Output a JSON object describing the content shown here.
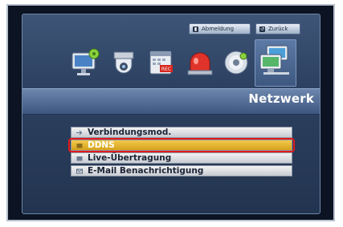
{
  "header": {
    "logout_label": "Abmeldung",
    "back_label": "Zurück"
  },
  "categories": [
    {
      "icon": "monitor-gear-icon"
    },
    {
      "icon": "camera-icon"
    },
    {
      "icon": "calendar-rec-icon"
    },
    {
      "icon": "alarm-icon"
    },
    {
      "icon": "disk-icon"
    },
    {
      "icon": "network-icon",
      "active": true
    }
  ],
  "section_title": "Netzwerk",
  "menu": {
    "items": [
      {
        "label": "Verbindungsmod.",
        "selected": false
      },
      {
        "label": "DDNS",
        "selected": true
      },
      {
        "label": "Live-Übertragung",
        "selected": false
      },
      {
        "label": "E-Mail Benachrichtigung",
        "selected": false
      }
    ]
  },
  "colors": {
    "selected": "#e5b22d",
    "highlight_ring": "#e01b1b"
  }
}
